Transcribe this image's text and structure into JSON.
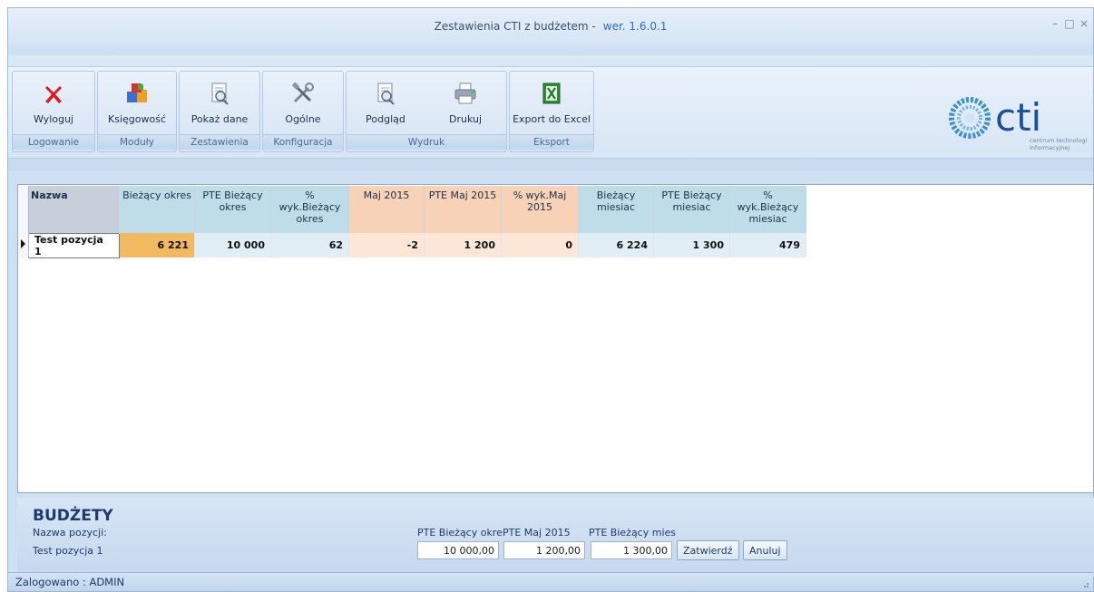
{
  "window": {
    "title": "Zestawienia CTI z budżetem -",
    "version": "wer. 1.6.0.1",
    "controls": {
      "minimize": "–",
      "maximize": "□",
      "close": "×"
    }
  },
  "ribbon": {
    "groups": [
      {
        "label": "Logowanie",
        "buttons": [
          {
            "label": "Wyloguj",
            "icon": "red-x-icon"
          }
        ]
      },
      {
        "label": "Moduły",
        "buttons": [
          {
            "label": "Księgowość",
            "icon": "accounting-cubes-icon"
          }
        ]
      },
      {
        "label": "Zestawienia",
        "buttons": [
          {
            "label": "Pokaż dane",
            "icon": "document-magnifier-icon"
          }
        ]
      },
      {
        "label": "Konfiguracja",
        "buttons": [
          {
            "label": "Ogólne",
            "icon": "tools-icon"
          }
        ]
      },
      {
        "label": "Wydruk",
        "buttons": [
          {
            "label": "Podgląd",
            "icon": "print-preview-icon"
          },
          {
            "label": "Drukuj",
            "icon": "printer-icon"
          }
        ]
      },
      {
        "label": "Eksport",
        "buttons": [
          {
            "label": "Export do Excel",
            "icon": "excel-icon"
          }
        ]
      }
    ]
  },
  "logo": {
    "name": "cti",
    "subtitle_line1": "centrum technologii",
    "subtitle_line2": "informacyjnej"
  },
  "grid": {
    "columns": [
      {
        "label": "Nazwa"
      },
      {
        "label": "Bieżący okres"
      },
      {
        "label": "PTE Bieżący okres"
      },
      {
        "label": "% wyk.Bieżący okres"
      },
      {
        "label": "Maj 2015"
      },
      {
        "label": "PTE Maj 2015"
      },
      {
        "label": "% wyk.Maj 2015"
      },
      {
        "label": "Bieżący miesiac"
      },
      {
        "label": "PTE Bieżący miesiac"
      },
      {
        "label": "% wyk.Bieżący miesiac"
      }
    ],
    "rows": [
      {
        "cells": [
          "Test pozycja 1",
          "6 221",
          "10 000",
          "62",
          "-2",
          "1 200",
          "0",
          "6 224",
          "1 300",
          "479"
        ]
      }
    ],
    "colors": {
      "header_gray": "#c6cfda",
      "header_blue": "#bfdde8",
      "header_peach": "#f8d2b6",
      "cell_orange": "#f1b960"
    }
  },
  "budget": {
    "title": "BUDŻETY",
    "name_label": "Nazwa pozycji:",
    "name_value": "Test pozycja 1",
    "fields": [
      {
        "label": "PTE Bieżący okre",
        "value": "10 000,00"
      },
      {
        "label": "PTE Maj 2015",
        "value": "1 200,00"
      },
      {
        "label": "PTE Bieżący mies",
        "value": "1 300,00"
      }
    ],
    "confirm_label": "Zatwierdź",
    "cancel_label": "Anuluj"
  },
  "status": {
    "text": "Zalogowano : ADMIN"
  }
}
